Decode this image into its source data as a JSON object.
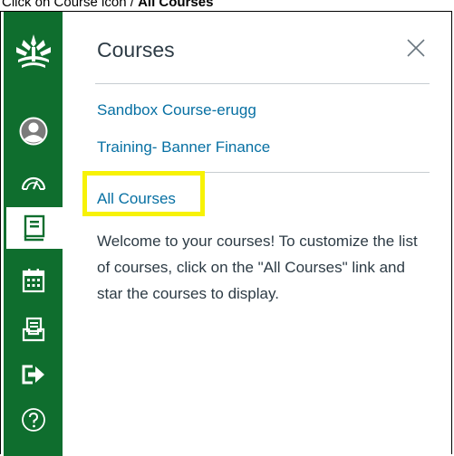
{
  "caption": {
    "prefix": "Click on Course icon / ",
    "bold": "All Courses"
  },
  "sidebar": {
    "items": [
      {
        "name": "logo",
        "icon": "tree-logo-icon"
      },
      {
        "name": "account",
        "icon": "avatar-icon"
      },
      {
        "name": "dashboard",
        "icon": "speedometer-icon"
      },
      {
        "name": "courses",
        "icon": "book-icon",
        "active": true
      },
      {
        "name": "calendar",
        "icon": "calendar-icon"
      },
      {
        "name": "inbox",
        "icon": "inbox-icon"
      },
      {
        "name": "logout",
        "icon": "logout-arrow-icon"
      },
      {
        "name": "help",
        "icon": "help-icon"
      }
    ]
  },
  "tray": {
    "title": "Courses",
    "courses": [
      "Sandbox Course-erugg",
      "Training- Banner Finance"
    ],
    "all_courses": "All Courses",
    "welcome": "Welcome to your courses! To customize the list of courses, click on the \"All Courses\" link and star the courses to display."
  },
  "colors": {
    "sidebar": "#0f6e2e",
    "link": "#0770a3",
    "highlight": "#f7f206",
    "text": "#2d3b45"
  }
}
